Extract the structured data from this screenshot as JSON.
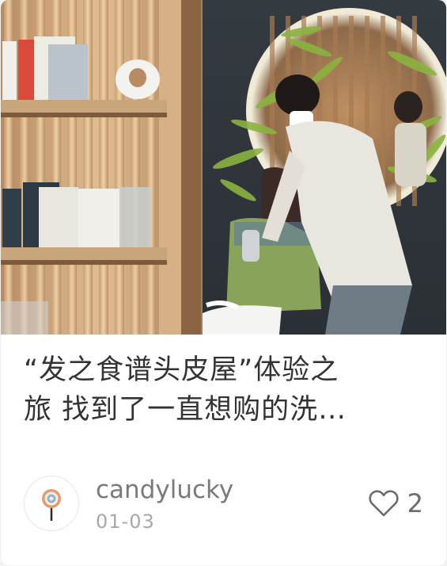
{
  "card": {
    "image": {
      "description_icon": "photo-hair-salon",
      "alt": ""
    },
    "title": "“发之食谱头皮屋”体验之\n旅 找到了一直想购的洗…",
    "author": {
      "name": "candylucky",
      "avatar_icon": "avatar-icon"
    },
    "date": "01-03",
    "likes": {
      "icon": "heart-outline-icon",
      "count": "2"
    }
  },
  "colors": {
    "title": "#333333",
    "author": "#7a7a7a",
    "date": "#a8a8a8",
    "like": "#6b6b6b"
  }
}
